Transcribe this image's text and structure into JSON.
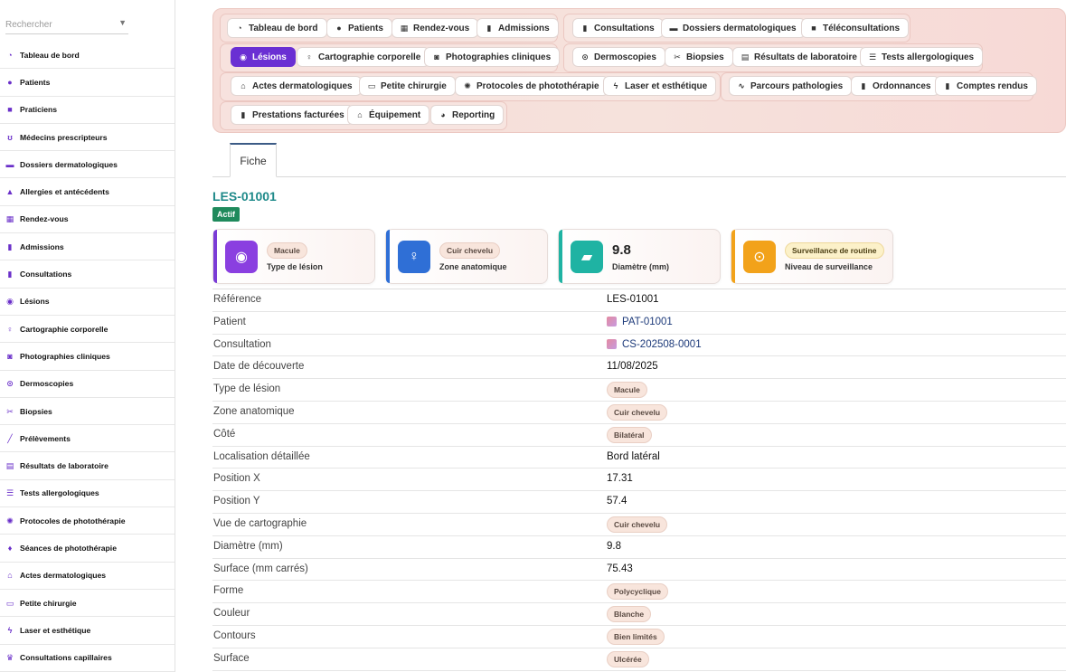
{
  "sidebar": {
    "search_placeholder": "Rechercher",
    "items": [
      {
        "label": "Tableau de bord",
        "icon": "dashboard-icon",
        "glyph": "◔"
      },
      {
        "label": "Patients",
        "icon": "user-icon",
        "glyph": "●"
      },
      {
        "label": "Praticiens",
        "icon": "user-doctor-icon",
        "glyph": "■"
      },
      {
        "label": "Médecins prescripteurs",
        "icon": "stethoscope-icon",
        "glyph": "ʊ"
      },
      {
        "label": "Dossiers dermatologiques",
        "icon": "folder-icon",
        "glyph": "▬"
      },
      {
        "label": "Allergies et antécédents",
        "icon": "warning-icon",
        "glyph": "▲"
      },
      {
        "label": "Rendez-vous",
        "icon": "calendar-icon",
        "glyph": "▦"
      },
      {
        "label": "Admissions",
        "icon": "clipboard-icon",
        "glyph": "▮"
      },
      {
        "label": "Consultations",
        "icon": "file-medical-icon",
        "glyph": "▮"
      },
      {
        "label": "Lésions",
        "icon": "circle-dot-icon",
        "glyph": "◉"
      },
      {
        "label": "Cartographie corporelle",
        "icon": "body-icon",
        "glyph": "♀"
      },
      {
        "label": "Photographies cliniques",
        "icon": "camera-icon",
        "glyph": "◙"
      },
      {
        "label": "Dermoscopies",
        "icon": "magnifier-icon",
        "glyph": "⊙"
      },
      {
        "label": "Biopsies",
        "icon": "scissors-icon",
        "glyph": "✂"
      },
      {
        "label": "Prélèvements",
        "icon": "syringe-icon",
        "glyph": "╱"
      },
      {
        "label": "Résultats de laboratoire",
        "icon": "lab-report-icon",
        "glyph": "▤"
      },
      {
        "label": "Tests allergologiques",
        "icon": "tests-icon",
        "glyph": "☰"
      },
      {
        "label": "Protocoles de photothérapie",
        "icon": "sun-icon",
        "glyph": "✺"
      },
      {
        "label": "Séances de photothérapie",
        "icon": "lightbulb-icon",
        "glyph": "♦"
      },
      {
        "label": "Actes dermatologiques",
        "icon": "hand-holding-icon",
        "glyph": "⌂"
      },
      {
        "label": "Petite chirurgie",
        "icon": "bed-icon",
        "glyph": "▭"
      },
      {
        "label": "Laser et esthétique",
        "icon": "bolt-icon",
        "glyph": "ϟ"
      },
      {
        "label": "Consultations capillaires",
        "icon": "crown-icon",
        "glyph": "♛"
      }
    ]
  },
  "toolbar": {
    "buttons": [
      {
        "label": "Tableau de bord",
        "icon": "dashboard-icon",
        "glyph": "◔"
      },
      {
        "label": "Patients",
        "icon": "user-icon",
        "glyph": "●"
      },
      {
        "label": "Rendez-vous",
        "icon": "calendar-icon",
        "glyph": "▦"
      },
      {
        "label": "Admissions",
        "icon": "clipboard-icon",
        "glyph": "▮"
      },
      {
        "label": "Consultations",
        "icon": "file-medical-icon",
        "glyph": "▮"
      },
      {
        "label": "Dossiers dermatologiques",
        "icon": "folder-icon",
        "glyph": "▬"
      },
      {
        "label": "Téléconsultations",
        "icon": "video-icon",
        "glyph": "■"
      },
      {
        "label": "Lésions",
        "icon": "circle-dot-icon",
        "glyph": "◉",
        "active": true
      },
      {
        "label": "Cartographie corporelle",
        "icon": "body-icon",
        "glyph": "♀"
      },
      {
        "label": "Photographies cliniques",
        "icon": "camera-icon",
        "glyph": "◙"
      },
      {
        "label": "Dermoscopies",
        "icon": "magnifier-icon",
        "glyph": "⊙"
      },
      {
        "label": "Biopsies",
        "icon": "scissors-icon",
        "glyph": "✂"
      },
      {
        "label": "Résultats de laboratoire",
        "icon": "lab-report-icon",
        "glyph": "▤"
      },
      {
        "label": "Tests allergologiques",
        "icon": "tests-icon",
        "glyph": "☰"
      },
      {
        "label": "Actes dermatologiques",
        "icon": "hand-holding-icon",
        "glyph": "⌂"
      },
      {
        "label": "Petite chirurgie",
        "icon": "bed-icon",
        "glyph": "▭"
      },
      {
        "label": "Protocoles de photothérapie",
        "icon": "sun-icon",
        "glyph": "✺"
      },
      {
        "label": "Laser et esthétique",
        "icon": "bolt-icon",
        "glyph": "ϟ"
      },
      {
        "label": "Parcours pathologies",
        "icon": "route-icon",
        "glyph": "∿"
      },
      {
        "label": "Ordonnances",
        "icon": "prescription-icon",
        "glyph": "▮"
      },
      {
        "label": "Comptes rendus",
        "icon": "report-icon",
        "glyph": "▮"
      },
      {
        "label": "Prestations facturées",
        "icon": "invoice-icon",
        "glyph": "▮"
      },
      {
        "label": "Équipement",
        "icon": "equipment-icon",
        "glyph": "⌂"
      },
      {
        "label": "Reporting",
        "icon": "chart-pie-icon",
        "glyph": "◕"
      }
    ]
  },
  "tabs": {
    "fiche": "Fiche"
  },
  "record": {
    "title": "LES-01001",
    "status": "Actif",
    "colors": {
      "accent": "#6a2fd3",
      "title": "#1f8a8a",
      "status": "#1f8a5c"
    }
  },
  "cards": [
    {
      "value": "Macule",
      "label": "Type de lésion",
      "icon": "circle-dot-icon",
      "glyph": "◉",
      "color": "#8a3fe0",
      "bar": "#7a3bd6"
    },
    {
      "value": "Cuir chevelu",
      "label": "Zone anatomique",
      "icon": "body-icon",
      "glyph": "♀",
      "color": "#2f6fd6",
      "bar": "#2f6fd6"
    },
    {
      "value": "9.8",
      "label": "Diamètre (mm)",
      "icon": "ruler-icon",
      "glyph": "▰",
      "color": "#1fb3a3",
      "bar": "#1fb3a3"
    },
    {
      "value": "Surveillance de routine",
      "label": "Niveau de surveillance",
      "icon": "magnifier-icon",
      "glyph": "⊙",
      "color": "#f2a21a",
      "bar": "#f2a21a"
    }
  ],
  "details": [
    {
      "key": "Référence",
      "value": "LES-01001"
    },
    {
      "key": "Patient",
      "value": "PAT-01001",
      "link": true
    },
    {
      "key": "Consultation",
      "value": "CS-202508-0001",
      "link": true
    },
    {
      "key": "Date de découverte",
      "value": "11/08/2025"
    },
    {
      "key": "Type de lésion",
      "value": "Macule",
      "pill": true
    },
    {
      "key": "Zone anatomique",
      "value": "Cuir chevelu",
      "pill": true
    },
    {
      "key": "Côté",
      "value": "Bilatéral",
      "pill": true
    },
    {
      "key": "Localisation détaillée",
      "value": "Bord latéral"
    },
    {
      "key": "Position X",
      "value": "17.31"
    },
    {
      "key": "Position Y",
      "value": "57.4"
    },
    {
      "key": "Vue de cartographie",
      "value": "Cuir chevelu",
      "pill": true
    },
    {
      "key": "Diamètre (mm)",
      "value": "9.8"
    },
    {
      "key": "Surface (mm carrés)",
      "value": "75.43"
    },
    {
      "key": "Forme",
      "value": "Polycyclique",
      "pill": true
    },
    {
      "key": "Couleur",
      "value": "Blanche",
      "pill": true
    },
    {
      "key": "Contours",
      "value": "Bien limités",
      "pill": true
    },
    {
      "key": "Surface",
      "value": "Ulcérée",
      "pill": true
    }
  ]
}
